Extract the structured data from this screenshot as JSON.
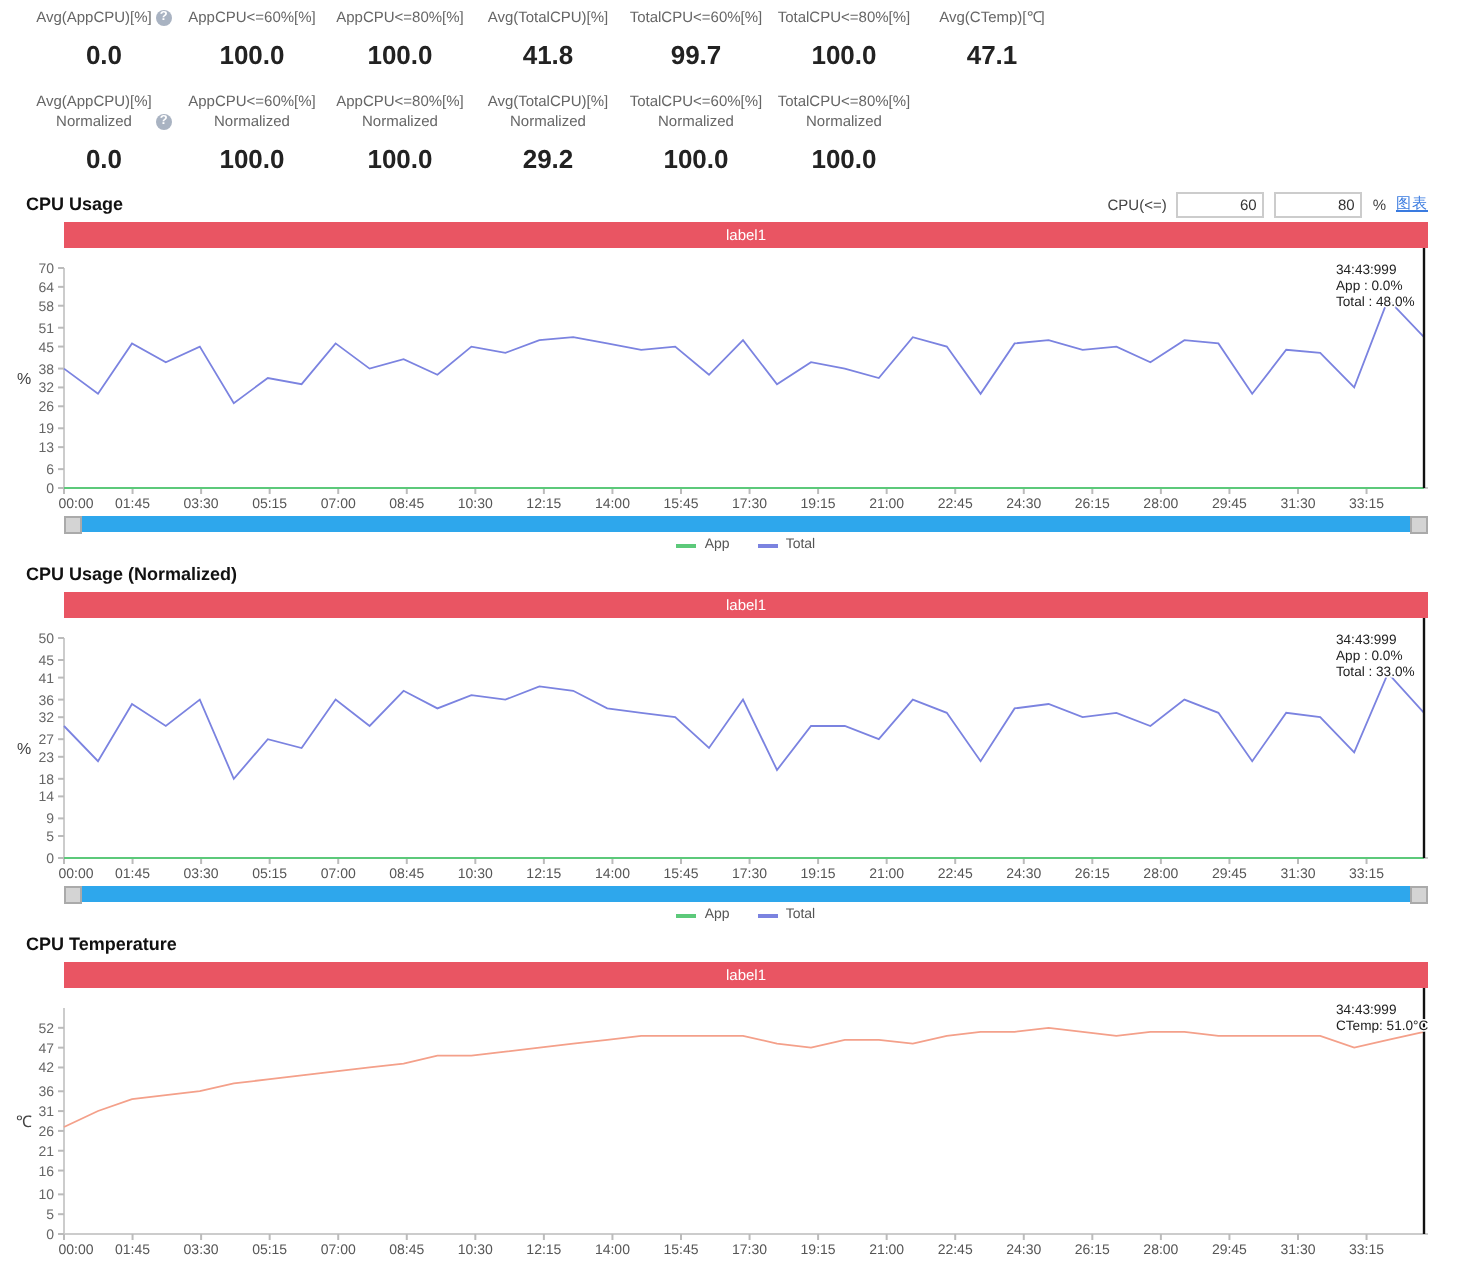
{
  "stats": [
    [
      {
        "label": "Avg(AppCPU)[%]",
        "value": "0.0",
        "help": "?"
      },
      {
        "label": "AppCPU<=60%[%]",
        "value": "100.0"
      },
      {
        "label": "AppCPU<=80%[%]",
        "value": "100.0"
      },
      {
        "label": "Avg(TotalCPU)[%]",
        "value": "41.8"
      },
      {
        "label": "TotalCPU<=60%[%]",
        "value": "99.7"
      },
      {
        "label": "TotalCPU<=80%[%]",
        "value": "100.0"
      },
      {
        "label": "Avg(CTemp)[℃]",
        "value": "47.1"
      }
    ],
    [
      {
        "label": "Avg(AppCPU)[%]",
        "sublabel": "Normalized",
        "value": "0.0",
        "help": "?"
      },
      {
        "label": "AppCPU<=60%[%]",
        "sublabel": "Normalized",
        "value": "100.0"
      },
      {
        "label": "AppCPU<=80%[%]",
        "sublabel": "Normalized",
        "value": "100.0"
      },
      {
        "label": "Avg(TotalCPU)[%]",
        "sublabel": "Normalized",
        "value": "29.2"
      },
      {
        "label": "TotalCPU<=60%[%]",
        "sublabel": "Normalized",
        "value": "100.0"
      },
      {
        "label": "TotalCPU<=80%[%]",
        "sublabel": "Normalized",
        "value": "100.0"
      }
    ]
  ],
  "sections": [
    {
      "title": "CPU Usage",
      "threshold": {
        "label": "CPU(<=)",
        "low": "60",
        "high": "80",
        "unit": "%",
        "link": "图表"
      },
      "banner": "label1",
      "zoom_slider": {
        "level": 1
      },
      "legend": true,
      "cursor": {
        "time": "34:43:999",
        "lines": [
          "App : 0.0%",
          "Total : 48.0%"
        ]
      },
      "chart_data": {
        "type": "line",
        "ylabel": "%",
        "xlim": [
          0,
          2083
        ],
        "ylim": [
          0,
          70
        ],
        "yticks": [
          0,
          6,
          13,
          19,
          26,
          32,
          38,
          45,
          51,
          58,
          64,
          70
        ],
        "xticks": [
          {
            "value": 0,
            "label": "00:00"
          },
          {
            "value": 105,
            "label": "01:45"
          },
          {
            "value": 210,
            "label": "03:30"
          },
          {
            "value": 315,
            "label": "05:15"
          },
          {
            "value": 420,
            "label": "07:00"
          },
          {
            "value": 525,
            "label": "08:45"
          },
          {
            "value": 630,
            "label": "10:30"
          },
          {
            "value": 735,
            "label": "12:15"
          },
          {
            "value": 840,
            "label": "14:00"
          },
          {
            "value": 945,
            "label": "15:45"
          },
          {
            "value": 1050,
            "label": "17:30"
          },
          {
            "value": 1155,
            "label": "19:15"
          },
          {
            "value": 1260,
            "label": "21:00"
          },
          {
            "value": 1365,
            "label": "22:45"
          },
          {
            "value": 1470,
            "label": "24:30"
          },
          {
            "value": 1575,
            "label": "26:15"
          },
          {
            "value": 1680,
            "label": "28:00"
          },
          {
            "value": 1785,
            "label": "29:45"
          },
          {
            "value": 1890,
            "label": "31:30"
          },
          {
            "value": 1995,
            "label": "33:15"
          }
        ],
        "x": [
          0,
          52,
          104,
          156,
          208,
          260,
          312,
          364,
          416,
          468,
          520,
          572,
          624,
          676,
          728,
          780,
          832,
          884,
          936,
          988,
          1040,
          1092,
          1144,
          1196,
          1248,
          1300,
          1352,
          1404,
          1456,
          1508,
          1560,
          1612,
          1664,
          1716,
          1768,
          1820,
          1872,
          1924,
          1976,
          2028,
          2083
        ],
        "series": [
          {
            "name": "App",
            "color": "#5cc97a",
            "values": [
              0,
              0,
              0,
              0,
              0,
              0,
              0,
              0,
              0,
              0,
              0,
              0,
              0,
              0,
              0,
              0,
              0,
              0,
              0,
              0,
              0,
              0,
              0,
              0,
              0,
              0,
              0,
              0,
              0,
              0,
              0,
              0,
              0,
              0,
              0,
              0,
              0,
              0,
              0,
              0,
              0
            ]
          },
          {
            "name": "Total",
            "color": "#7b83e0",
            "values": [
              38,
              30,
              46,
              40,
              45,
              27,
              35,
              33,
              46,
              38,
              41,
              36,
              45,
              43,
              47,
              48,
              46,
              44,
              45,
              36,
              47,
              33,
              40,
              38,
              35,
              48,
              45,
              30,
              46,
              47,
              44,
              45,
              40,
              47,
              46,
              30,
              44,
              43,
              32,
              60,
              48
            ]
          }
        ]
      }
    },
    {
      "title": "CPU Usage (Normalized)",
      "banner": "label1",
      "zoom_slider": {
        "level": 1
      },
      "legend": true,
      "cursor": {
        "time": "34:43:999",
        "lines": [
          "App : 0.0%",
          "Total : 33.0%"
        ]
      },
      "chart_data": {
        "type": "line",
        "ylabel": "%",
        "xlim": [
          0,
          2083
        ],
        "ylim": [
          0,
          50
        ],
        "yticks": [
          0,
          5,
          9,
          14,
          18,
          23,
          27,
          32,
          36,
          41,
          45,
          50
        ],
        "xticks": [
          {
            "value": 0,
            "label": "00:00"
          },
          {
            "value": 105,
            "label": "01:45"
          },
          {
            "value": 210,
            "label": "03:30"
          },
          {
            "value": 315,
            "label": "05:15"
          },
          {
            "value": 420,
            "label": "07:00"
          },
          {
            "value": 525,
            "label": "08:45"
          },
          {
            "value": 630,
            "label": "10:30"
          },
          {
            "value": 735,
            "label": "12:15"
          },
          {
            "value": 840,
            "label": "14:00"
          },
          {
            "value": 945,
            "label": "15:45"
          },
          {
            "value": 1050,
            "label": "17:30"
          },
          {
            "value": 1155,
            "label": "19:15"
          },
          {
            "value": 1260,
            "label": "21:00"
          },
          {
            "value": 1365,
            "label": "22:45"
          },
          {
            "value": 1470,
            "label": "24:30"
          },
          {
            "value": 1575,
            "label": "26:15"
          },
          {
            "value": 1680,
            "label": "28:00"
          },
          {
            "value": 1785,
            "label": "29:45"
          },
          {
            "value": 1890,
            "label": "31:30"
          },
          {
            "value": 1995,
            "label": "33:15"
          }
        ],
        "x": [
          0,
          52,
          104,
          156,
          208,
          260,
          312,
          364,
          416,
          468,
          520,
          572,
          624,
          676,
          728,
          780,
          832,
          884,
          936,
          988,
          1040,
          1092,
          1144,
          1196,
          1248,
          1300,
          1352,
          1404,
          1456,
          1508,
          1560,
          1612,
          1664,
          1716,
          1768,
          1820,
          1872,
          1924,
          1976,
          2028,
          2083
        ],
        "series": [
          {
            "name": "App",
            "color": "#5cc97a",
            "values": [
              0,
              0,
              0,
              0,
              0,
              0,
              0,
              0,
              0,
              0,
              0,
              0,
              0,
              0,
              0,
              0,
              0,
              0,
              0,
              0,
              0,
              0,
              0,
              0,
              0,
              0,
              0,
              0,
              0,
              0,
              0,
              0,
              0,
              0,
              0,
              0,
              0,
              0,
              0,
              0,
              0
            ]
          },
          {
            "name": "Total",
            "color": "#7b83e0",
            "values": [
              30,
              22,
              35,
              30,
              36,
              18,
              27,
              25,
              36,
              30,
              38,
              34,
              37,
              36,
              39,
              38,
              34,
              33,
              32,
              25,
              36,
              20,
              30,
              30,
              27,
              36,
              33,
              22,
              34,
              35,
              32,
              33,
              30,
              36,
              33,
              22,
              33,
              32,
              24,
              42,
              33
            ]
          }
        ]
      }
    },
    {
      "title": "CPU Temperature",
      "banner": "label1",
      "cursor": {
        "time": "34:43:999",
        "lines": [
          "CTemp: 51.0°C"
        ]
      },
      "chart_data": {
        "type": "line",
        "ylabel": "℃",
        "xlim": [
          0,
          2083
        ],
        "ylim": [
          0,
          57
        ],
        "yticks": [
          0,
          5,
          10,
          16,
          21,
          26,
          31,
          36,
          42,
          47,
          52
        ],
        "xticks": [
          {
            "value": 0,
            "label": "00:00"
          },
          {
            "value": 105,
            "label": "01:45"
          },
          {
            "value": 210,
            "label": "03:30"
          },
          {
            "value": 315,
            "label": "05:15"
          },
          {
            "value": 420,
            "label": "07:00"
          },
          {
            "value": 525,
            "label": "08:45"
          },
          {
            "value": 630,
            "label": "10:30"
          },
          {
            "value": 735,
            "label": "12:15"
          },
          {
            "value": 840,
            "label": "14:00"
          },
          {
            "value": 945,
            "label": "15:45"
          },
          {
            "value": 1050,
            "label": "17:30"
          },
          {
            "value": 1155,
            "label": "19:15"
          },
          {
            "value": 1260,
            "label": "21:00"
          },
          {
            "value": 1365,
            "label": "22:45"
          },
          {
            "value": 1470,
            "label": "24:30"
          },
          {
            "value": 1575,
            "label": "26:15"
          },
          {
            "value": 1680,
            "label": "28:00"
          },
          {
            "value": 1785,
            "label": "29:45"
          },
          {
            "value": 1890,
            "label": "31:30"
          },
          {
            "value": 1995,
            "label": "33:15"
          }
        ],
        "x": [
          0,
          52,
          104,
          156,
          208,
          260,
          312,
          364,
          416,
          468,
          520,
          572,
          624,
          676,
          728,
          780,
          832,
          884,
          936,
          988,
          1040,
          1092,
          1144,
          1196,
          1248,
          1300,
          1352,
          1404,
          1456,
          1508,
          1560,
          1612,
          1664,
          1716,
          1768,
          1820,
          1872,
          1924,
          1976,
          2028,
          2083
        ],
        "series": [
          {
            "color": "#f4a08a",
            "values": [
              27,
              31,
              34,
              35,
              36,
              38,
              39,
              40,
              41,
              42,
              43,
              45,
              45,
              46,
              47,
              48,
              49,
              50,
              50,
              50,
              50,
              48,
              47,
              49,
              49,
              48,
              50,
              51,
              51,
              52,
              51,
              50,
              51,
              51,
              50,
              50,
              50,
              50,
              47,
              49,
              51
            ]
          }
        ]
      }
    }
  ]
}
